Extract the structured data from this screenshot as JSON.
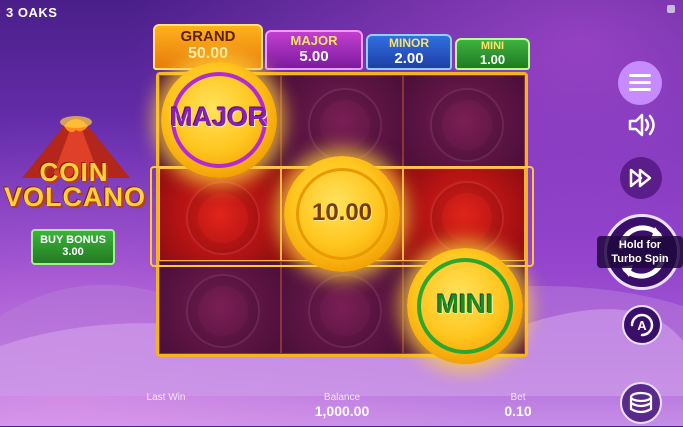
{
  "brand": "3 OAKS",
  "game": {
    "logo_line1": "COIN",
    "logo_line2": "VOLCANO"
  },
  "jackpots": {
    "grand": {
      "name": "GRAND",
      "value": "50.00"
    },
    "major": {
      "name": "MAJOR",
      "value": "5.00"
    },
    "minor": {
      "name": "MINOR",
      "value": "2.00"
    },
    "mini": {
      "name": "MINI",
      "value": "1.00"
    }
  },
  "buy_bonus": {
    "label": "BUY BONUS",
    "price": "3.00"
  },
  "coins": {
    "major_coin": "MAJOR",
    "value_coin": "10.00",
    "mini_coin": "MINI"
  },
  "controls": {
    "turbo_hint_line1": "Hold for",
    "turbo_hint_line2": "Turbo Spin",
    "auto_letter": "A"
  },
  "stats": {
    "last_win_label": "Last Win",
    "balance_label": "Balance",
    "balance_value": "1,000.00",
    "bet_label": "Bet",
    "bet_value": "0.10"
  },
  "colors": {
    "grand": "#e77a0c",
    "major": "#7b1aa0",
    "minor": "#1f3fa8",
    "mini": "#1f7a24",
    "frame": "#f5b41d",
    "hot_row": "#b81414"
  }
}
